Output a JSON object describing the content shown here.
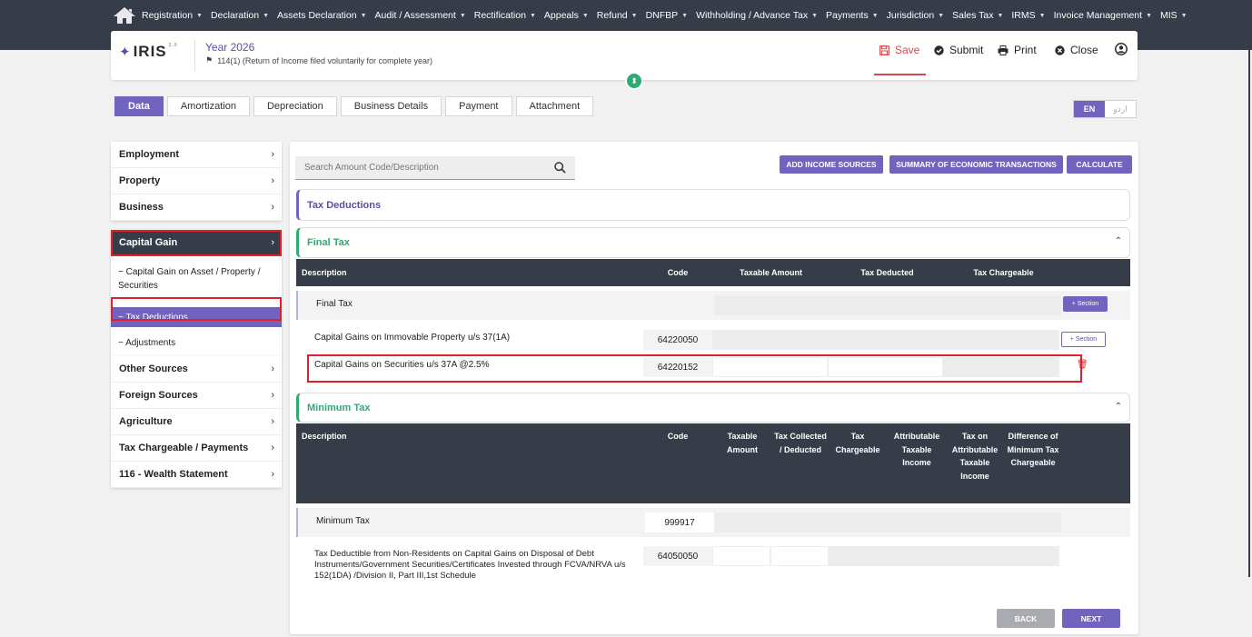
{
  "topnav": {
    "items": [
      "Registration",
      "Declaration",
      "Assets Declaration",
      "Audit / Assessment",
      "Rectification",
      "Appeals",
      "Refund",
      "DNFBP",
      "Withholding / Advance Tax",
      "Payments",
      "Jurisdiction",
      "Sales Tax",
      "IRMS",
      "Invoice Management",
      "MIS"
    ]
  },
  "header": {
    "logo": "IRIS",
    "logo_sup": "2.0",
    "year": "Year 2026",
    "return_type": "114(1) (Return of Income filed voluntarily for complete year)",
    "save_label": "Save",
    "submit_label": "Submit",
    "print_label": "Print",
    "close_label": "Close"
  },
  "tabs": [
    "Data",
    "Amortization",
    "Depreciation",
    "Business Details",
    "Payment",
    "Attachment"
  ],
  "lang": {
    "en": "EN",
    "ur": "اردو"
  },
  "sidebar": {
    "group1": [
      "Employment",
      "Property",
      "Business"
    ],
    "capital_gain": "Capital Gain",
    "capital_subs": [
      "− Capital Gain on Asset / Property / Securities",
      "− Tax Deductions",
      "− Adjustments"
    ],
    "group3": [
      "Other Sources",
      "Foreign Sources",
      "Agriculture",
      "Tax Chargeable / Payments",
      "116 - Wealth Statement"
    ]
  },
  "search": {
    "placeholder": "Search Amount Code/Description"
  },
  "actions": {
    "add_income": "ADD INCOME SOURCES",
    "summary": "SUMMARY OF ECONOMIC TRANSACTIONS",
    "calculate": "CALCULATE"
  },
  "sections": {
    "tax_deductions": "Tax Deductions",
    "final_tax": "Final Tax",
    "minimum_tax": "Minimum Tax"
  },
  "final_table": {
    "headers": [
      "Description",
      "Code",
      "Taxable Amount",
      "Tax Deducted",
      "Tax Chargeable"
    ],
    "rows": [
      {
        "desc": "Final Tax",
        "code": "",
        "btn": "+ Section"
      },
      {
        "desc": "Capital Gains on Immovable Property u/s 37(1A)",
        "code": "64220050",
        "btn": "+ Section"
      },
      {
        "desc": "Capital Gains on Securities u/s 37A @2.5%",
        "code": "64220152"
      }
    ]
  },
  "min_table": {
    "headers": {
      "desc": "Description",
      "code": "Code",
      "taxable": "Taxable Amount",
      "collected": "Tax Collected / Deducted",
      "chargeable": "Tax Chargeable",
      "attr_income": "Attributable Taxable Income",
      "tax_attr": "Tax on Attributable Taxable Income",
      "difference": "Difference of Minimum Tax Chargeable"
    },
    "rows": [
      {
        "desc": "Minimum Tax",
        "code": "999917"
      },
      {
        "desc": "Tax Deductible from Non-Residents on Capital Gains on Disposal of Debt Instruments/Government Securities/Certificates Invested through FCVA/NRVA u/s 152(1DA) /Division II, Part III,1st Schedule",
        "code": "64050050"
      }
    ]
  },
  "footer": {
    "back": "BACK",
    "next": "NEXT"
  },
  "colors": {
    "primary": "#7164be",
    "nav_dark": "#363d49",
    "success": "#2eaa72",
    "danger": "#e0202a"
  }
}
